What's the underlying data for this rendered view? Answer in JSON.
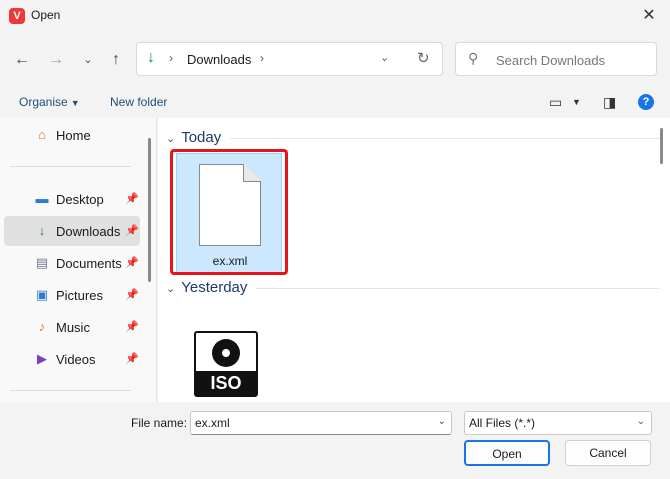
{
  "window": {
    "title": "Open"
  },
  "nav": {
    "address_folder": "Downloads",
    "search_placeholder": "Search Downloads"
  },
  "toolbar": {
    "organise_label": "Organise",
    "new_folder_label": "New folder"
  },
  "sidebar": {
    "items": [
      {
        "label": "Home",
        "icon": "home-icon",
        "pinned": false
      },
      {
        "label": "Desktop",
        "icon": "desktop-icon",
        "pinned": true
      },
      {
        "label": "Downloads",
        "icon": "download-icon",
        "pinned": true,
        "selected": true
      },
      {
        "label": "Documents",
        "icon": "documents-icon",
        "pinned": true
      },
      {
        "label": "Pictures",
        "icon": "pictures-icon",
        "pinned": true
      },
      {
        "label": "Music",
        "icon": "music-icon",
        "pinned": true
      },
      {
        "label": "Videos",
        "icon": "videos-icon",
        "pinned": true
      }
    ]
  },
  "content": {
    "groups": [
      {
        "label": "Today",
        "files": [
          {
            "name": "ex.xml",
            "icon": "document-icon",
            "selected": true
          }
        ]
      },
      {
        "label": "Yesterday",
        "files": [
          {
            "name": "",
            "icon": "iso-icon"
          }
        ]
      }
    ]
  },
  "bottom": {
    "file_name_label": "File name:",
    "file_name_value": "ex.xml",
    "filter_value": "All Files (*.*)",
    "open_label": "Open",
    "cancel_label": "Cancel"
  },
  "colors": {
    "accent": "#1a73e8",
    "selection": "#cce8ff",
    "highlight": "#e8141c",
    "download_green": "#1a8e3b"
  }
}
